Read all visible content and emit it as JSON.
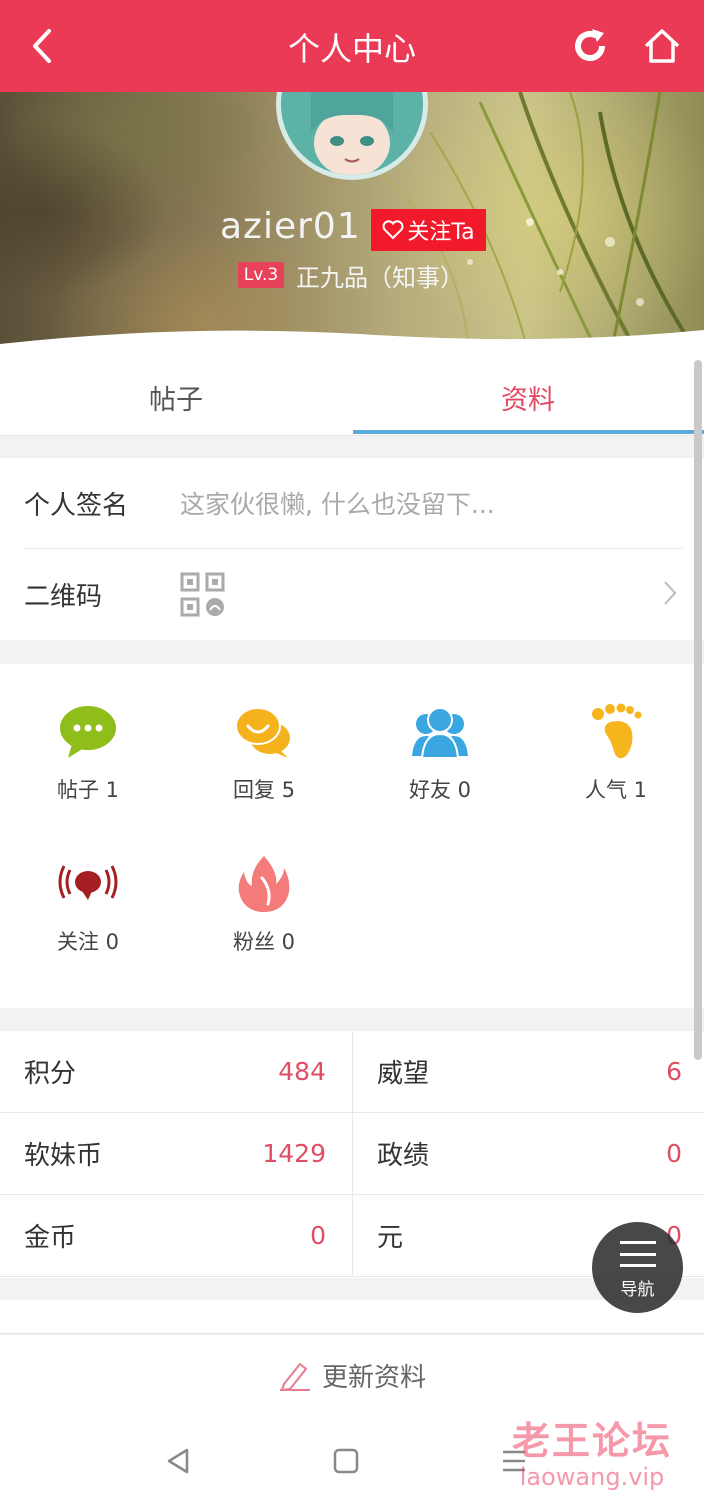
{
  "header": {
    "title": "个人中心",
    "back_icon": "back-arrow-icon",
    "refresh_icon": "refresh-icon",
    "home_icon": "home-icon",
    "bg_color": "#ea3a55"
  },
  "profile": {
    "username": "azier01",
    "follow_label": "关注Ta",
    "level": "Lv.3",
    "rank": "正九品（知事）"
  },
  "tabs": [
    {
      "label": "帖子",
      "active": false
    },
    {
      "label": "资料",
      "active": true
    }
  ],
  "info": {
    "signature_label": "个人签名",
    "signature_value": "这家伙很懒, 什么也没留下...",
    "qr_label": "二维码"
  },
  "stats": [
    {
      "label": "帖子 1",
      "icon": "chat-bubble-icon",
      "color": "#8fbd1a"
    },
    {
      "label": "回复 5",
      "icon": "reply-bubbles-icon",
      "color": "#f5b21d"
    },
    {
      "label": "好友 0",
      "icon": "friends-icon",
      "color": "#3aa7e3"
    },
    {
      "label": "人气 1",
      "icon": "footprint-icon",
      "color": "#f6b51c"
    },
    {
      "label": "关注 0",
      "icon": "broadcast-icon",
      "color": "#a41e22"
    },
    {
      "label": "粉丝 0",
      "icon": "flame-icon",
      "color": "#f57a7a"
    }
  ],
  "credits": [
    {
      "label": "积分",
      "value": "484"
    },
    {
      "label": "威望",
      "value": "6"
    },
    {
      "label": "软妹币",
      "value": "1429"
    },
    {
      "label": "政绩",
      "value": "0"
    },
    {
      "label": "金币",
      "value": "0"
    },
    {
      "label": "元",
      "value": "0"
    }
  ],
  "update_label": "更新资料",
  "fab_label": "导航",
  "watermark": {
    "line1": "老王论坛",
    "line2": "laowang.vip"
  },
  "accent": "#e24a64",
  "tab_indicator_color": "#5aaadc"
}
